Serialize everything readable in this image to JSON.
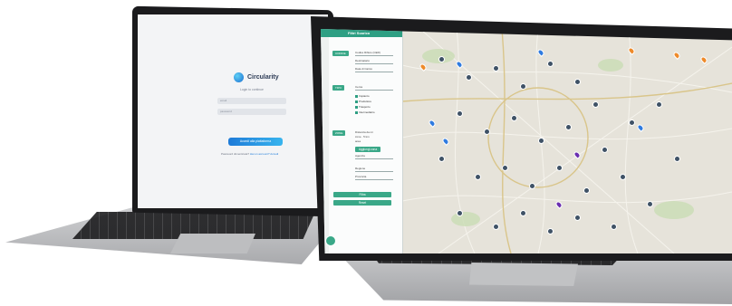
{
  "login": {
    "brand": "Circularity",
    "subtitle": "Login to continue",
    "username_placeholder": "email",
    "password_placeholder": "password",
    "submit_label": "Accedi alla piattaforma",
    "footer_text": "Password dimenticata?",
    "footer_link": "Hai un account? Accedi"
  },
  "panel": {
    "title": "Filtri Scarico",
    "section1_pill": "CODICE",
    "select1": "Codice Rifiuto (CER)",
    "select2": "Destinatario",
    "select3": "Data di Carico",
    "section2_pill": "TIPO",
    "search_placeholder": "Cerca",
    "checkboxes": [
      "Impianto",
      "Produttore",
      "Trasporto",
      "Intermediario"
    ],
    "section3_pill": "ZONE",
    "zone_lines": [
      "Distanza da mi",
      "zone · 5 km",
      "area"
    ],
    "zone_button": "Aggiungi zona",
    "zone_extra": "Agenzia",
    "select4": "Regione",
    "select5": "Provincia",
    "btn_apply": "Filtra",
    "btn_reset": "Reset"
  },
  "colors": {
    "accent": "#2e9f83",
    "login_accent": "#1e7bd8",
    "cluster": "#3f5266",
    "pin_blue": "#2f7be0",
    "pin_orange": "#ee8a2a",
    "pin_purple": "#6a2fb0"
  },
  "icons": [
    "circularity-logo-icon",
    "map-cluster-icon",
    "map-pin-icon",
    "chat-icon"
  ]
}
